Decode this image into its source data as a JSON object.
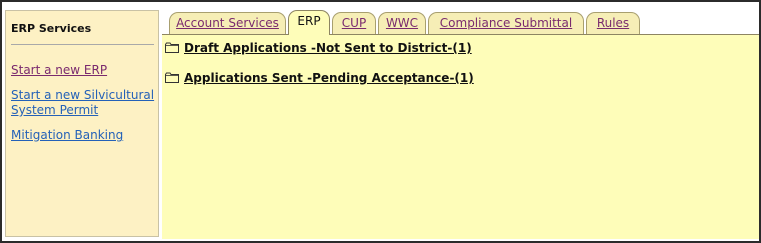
{
  "sidebar": {
    "title": "ERP Services",
    "links": [
      {
        "label": "Start a new ERP",
        "state": "visited"
      },
      {
        "label_lines": [
          "Start a new Silvicultural",
          "System Permit"
        ],
        "state": "normal"
      },
      {
        "label": "Mitigation Banking",
        "state": "normal"
      }
    ]
  },
  "tabs": [
    {
      "label": "Account Services",
      "active": false
    },
    {
      "label": "ERP",
      "active": true
    },
    {
      "label": "CUP",
      "active": false
    },
    {
      "label": "WWC",
      "active": false
    },
    {
      "label": "Compliance Submittal",
      "active": false
    },
    {
      "label": "Rules",
      "active": false
    }
  ],
  "content": {
    "folders": [
      {
        "label": "Draft Applications -Not Sent to District-(1)",
        "icon": "folder-icon"
      },
      {
        "label": "Applications Sent -Pending Acceptance-(1)",
        "icon": "folder-icon"
      }
    ]
  },
  "colors": {
    "sidebar_bg": "#fdf1c4",
    "content_bg": "#fefdb9",
    "tab_bg": "#f6eeb6",
    "visited_link": "#7a2a6e",
    "link": "#2461b8"
  }
}
